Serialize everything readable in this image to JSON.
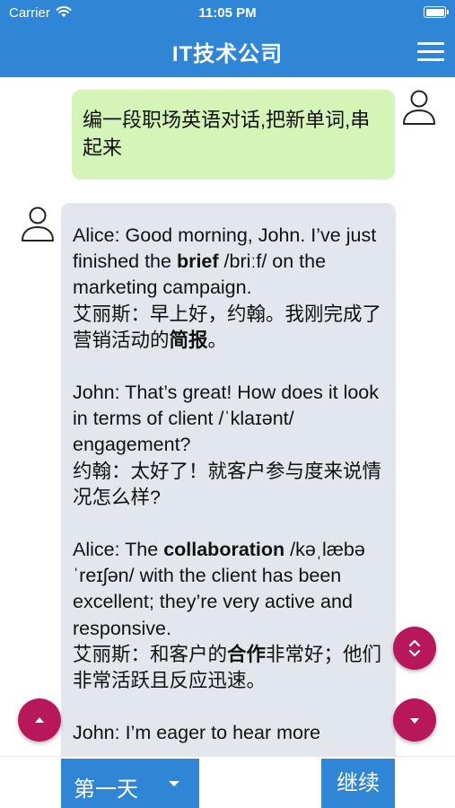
{
  "status_bar": {
    "carrier": "Carrier",
    "time": "11:05 PM"
  },
  "nav": {
    "title": "IT技术公司"
  },
  "user_message": {
    "text": "编一段职场英语对话,把新单词,串起来"
  },
  "bot_message": {
    "paragraphs": [
      {
        "lines": [
          {
            "pre": "Alice: Good morning, John. I’ve just finished the ",
            "bold": "brief",
            "post": " /briːf/ on the marketing campaign."
          },
          {
            "pre": "艾丽斯：早上好，约翰。我刚完成了营销活动的",
            "bold": "简报",
            "post": "。"
          }
        ]
      },
      {
        "lines": [
          {
            "pre": "John: That’s great! How does it look in terms of client /ˈklaɪənt/ engagement?",
            "bold": "",
            "post": ""
          },
          {
            "pre": "约翰：太好了！就客户参与度来说情况怎么样?",
            "bold": "",
            "post": ""
          }
        ]
      },
      {
        "lines": [
          {
            "pre": "Alice: The ",
            "bold": "collaboration",
            "post": " /kəˌlæbəˈreɪʃən/ with the client has been excellent; they’re very active and responsive."
          },
          {
            "pre": "艾丽斯：和客户的",
            "bold": "合作",
            "post": "非常好；他们非常活跃且反应迅速。"
          }
        ]
      },
      {
        "lines": [
          {
            "pre": "John: I’m eager to hear more",
            "bold": "",
            "post": ""
          }
        ]
      }
    ]
  },
  "bottom_bar": {
    "day_label": "第一天",
    "continue_label": "继续"
  },
  "colors": {
    "primary": "#2f86d6",
    "accent": "#b8185a",
    "user_bubble": "#d4f4b8",
    "bot_bubble": "#e2e7ee"
  },
  "icons": {
    "menu": "hamburger-menu-icon",
    "avatar": "person-outline-icon",
    "scroll_both": "chevron-up-down-icon",
    "scroll_down": "caret-down-icon",
    "scroll_up": "caret-up-icon"
  }
}
